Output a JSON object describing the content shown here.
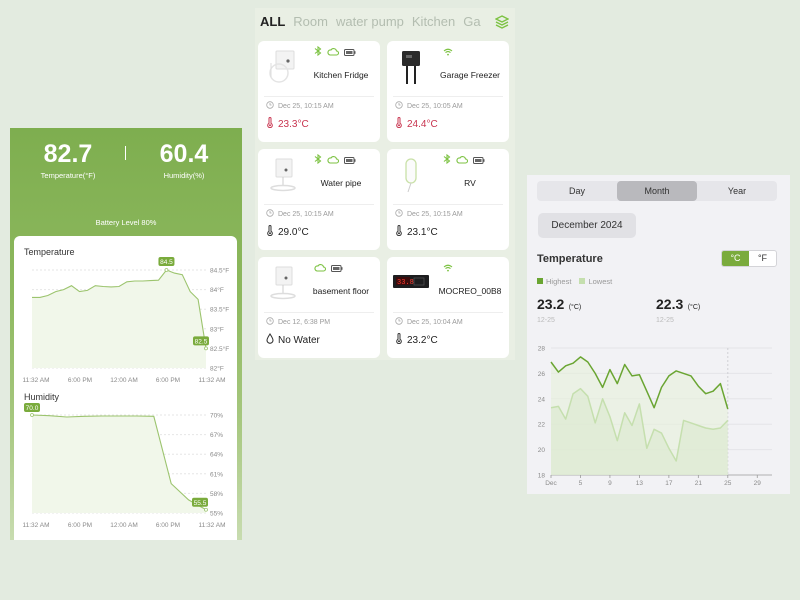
{
  "sensor_panel": {
    "temperature": {
      "value": "82.7",
      "label": "Temperature(°F)"
    },
    "humidity": {
      "value": "60.4",
      "label": "Humidity(%)"
    },
    "battery": "Battery Level 80%",
    "colors": {
      "accent": "#7aab3c",
      "line": "#9cc46e"
    },
    "temperature_chart": {
      "title": "Temperature",
      "y_ticks": [
        "84.5°F",
        "84°F",
        "83.5°F",
        "83°F",
        "82.5°F",
        "82°F"
      ],
      "x_ticks": [
        "11:32 AM",
        "6:00 PM",
        "12:00 AM",
        "6:00 PM",
        "11:32 AM"
      ],
      "ylim": [
        82,
        84.5
      ],
      "values": [
        83.8,
        83.8,
        83.85,
        83.95,
        84.0,
        84.1,
        83.95,
        83.98,
        84.1,
        84.08,
        84.07,
        84.08,
        84.2,
        84.22,
        84.22,
        84.23,
        84.24,
        84.5,
        84.42,
        84.38,
        83.95,
        83.75,
        82.5
      ],
      "max_label": "84.5",
      "last_label": "82.5"
    },
    "humidity_chart": {
      "title": "Humidity",
      "y_ticks": [
        "70%",
        "67%",
        "64%",
        "61%",
        "58%",
        "55%"
      ],
      "x_ticks": [
        "11:32 AM",
        "6:00 PM",
        "12:00 AM",
        "6:00 PM",
        "11:32 AM"
      ],
      "ylim": [
        55,
        70
      ],
      "values": [
        70.0,
        69.9,
        69.7,
        69.8,
        69.85,
        69.85,
        69.85,
        69.8,
        59.5,
        57.0,
        55.5
      ],
      "first_label": "70.0",
      "last_label": "55.5"
    }
  },
  "device_panel": {
    "tabs": [
      "ALL",
      "Room",
      "water pump",
      "Kitchen",
      "Ga"
    ],
    "active_tab": "ALL",
    "devices": [
      {
        "name": "Kitchen Fridge",
        "time": "Dec 25, 10:15 AM",
        "reading": "23.3°C",
        "reading_type": "temperature",
        "alert": true,
        "status_icons": [
          "bluetooth-icon",
          "cloud-icon",
          "battery-icon"
        ]
      },
      {
        "name": "Garage Freezer",
        "time": "Dec 25, 10:05 AM",
        "reading": "24.4°C",
        "reading_type": "temperature",
        "alert": true,
        "status_icons": [
          "wifi-icon"
        ]
      },
      {
        "name": "Water pipe",
        "time": "Dec 25, 10:15 AM",
        "reading": "29.0°C",
        "reading_type": "temperature",
        "alert": false,
        "status_icons": [
          "bluetooth-icon",
          "cloud-icon",
          "battery-icon"
        ]
      },
      {
        "name": "RV",
        "time": "Dec 25, 10:15 AM",
        "reading": "23.1°C",
        "reading_type": "temperature",
        "alert": false,
        "status_icons": [
          "bluetooth-icon",
          "cloud-icon",
          "battery-icon"
        ]
      },
      {
        "name": "basement floor",
        "time": "Dec 12, 6:38 PM",
        "reading": "No Water",
        "reading_type": "water",
        "alert": false,
        "status_icons": [
          "cloud-icon",
          "battery-icon"
        ]
      },
      {
        "name": "MOCREO_00B8",
        "time": "Dec 25, 10:04 AM",
        "reading": "23.2°C",
        "reading_type": "temperature",
        "alert": false,
        "status_icons": [
          "wifi-icon"
        ]
      }
    ],
    "colors": {
      "alert": "#c8344f",
      "icon_green": "#7cc242"
    }
  },
  "history_panel": {
    "range_tabs": [
      "Day",
      "Month",
      "Year"
    ],
    "active_range": "Month",
    "month_label": "December 2024",
    "title": "Temperature",
    "units": [
      "°C",
      "°F"
    ],
    "active_unit": "°C",
    "legend": [
      {
        "label": "Highest",
        "color": "#6aa532"
      },
      {
        "label": "Lowest",
        "color": "#c5dfae"
      }
    ],
    "highest": {
      "value": "23.2",
      "unit": "(°C)",
      "date": "12-25"
    },
    "lowest": {
      "value": "22.3",
      "unit": "(°C)",
      "date": "12-25"
    }
  },
  "chart_data": {
    "type": "area",
    "title": "Temperature",
    "xlabel": "",
    "ylabel": "",
    "x": [
      1,
      2,
      3,
      4,
      5,
      6,
      7,
      8,
      9,
      10,
      11,
      12,
      13,
      14,
      15,
      16,
      17,
      18,
      19,
      20,
      21,
      22,
      23,
      24,
      25
    ],
    "x_tick_values": [
      1,
      5,
      9,
      13,
      17,
      21,
      25,
      29
    ],
    "x_tick_labels": [
      "Dec",
      "5",
      "9",
      "13",
      "17",
      "21",
      "25",
      "29"
    ],
    "y_ticks": [
      18,
      20,
      22,
      24,
      26,
      28
    ],
    "xlim": [
      1,
      31
    ],
    "ylim": [
      18,
      28
    ],
    "grid": true,
    "legend": "top-left",
    "series": [
      {
        "name": "Highest",
        "color": "#6aa532",
        "values": [
          26.9,
          26.1,
          26.6,
          26.8,
          27.3,
          26.9,
          26.0,
          24.9,
          26.3,
          25.2,
          26.7,
          25.8,
          25.9,
          24.6,
          23.3,
          24.9,
          25.8,
          26.2,
          26.0,
          25.8,
          25.0,
          24.4,
          24.6,
          25.2,
          23.2
        ]
      },
      {
        "name": "Lowest",
        "color": "#c5dfae",
        "values": [
          23.3,
          23.4,
          22.4,
          24.4,
          24.8,
          24.2,
          22.1,
          24.0,
          22.6,
          20.7,
          22.9,
          21.9,
          23.6,
          20.1,
          21.6,
          21.3,
          20.1,
          19.1,
          22.3,
          22.1,
          21.9,
          21.7,
          21.6,
          21.7,
          22.3
        ]
      }
    ],
    "marker_x": 25
  }
}
